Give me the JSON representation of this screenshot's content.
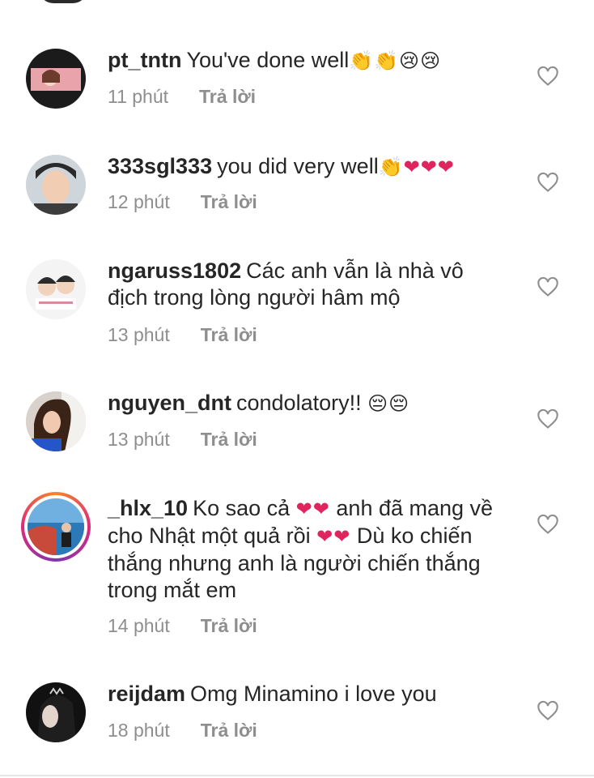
{
  "comments": [
    {
      "username": "pt_tntn",
      "text": "You've done well",
      "emojis": "👏👏😢😢",
      "time": "11 phút",
      "reply_label": "Trả lời"
    },
    {
      "username": "333sgl333",
      "text": "you did very well",
      "emojis": "👏❤❤❤",
      "time": "12 phút",
      "reply_label": "Trả lời"
    },
    {
      "username": "ngaruss1802",
      "text": "Các anh vẫn là nhà vô địch trong lòng người hâm mộ",
      "emojis": "",
      "time": "13 phút",
      "reply_label": "Trả lời"
    },
    {
      "username": "nguyen_dnt",
      "text": "condolatory!!",
      "emojis": "😔😔",
      "time": "13 phút",
      "reply_label": "Trả lời"
    },
    {
      "username": "_hlx_10",
      "text_part1": "Ko sao cả",
      "emojis1": "❤❤",
      "text_part2": "anh đã mang về cho Nhật một quả rồi",
      "emojis2": "❤❤",
      "text_part3": "Dù ko chiến thắng nhưng anh là người chiến thắng trong mắt em",
      "time": "14 phút",
      "reply_label": "Trả lời"
    },
    {
      "username": "reijdam",
      "text": "Omg Minamino i love you",
      "emojis": "",
      "time": "18 phút",
      "reply_label": "Trả lời"
    }
  ],
  "colors": {
    "text": "#262626",
    "meta": "#8e8e8e",
    "heart_emoji": "#e0245e"
  }
}
